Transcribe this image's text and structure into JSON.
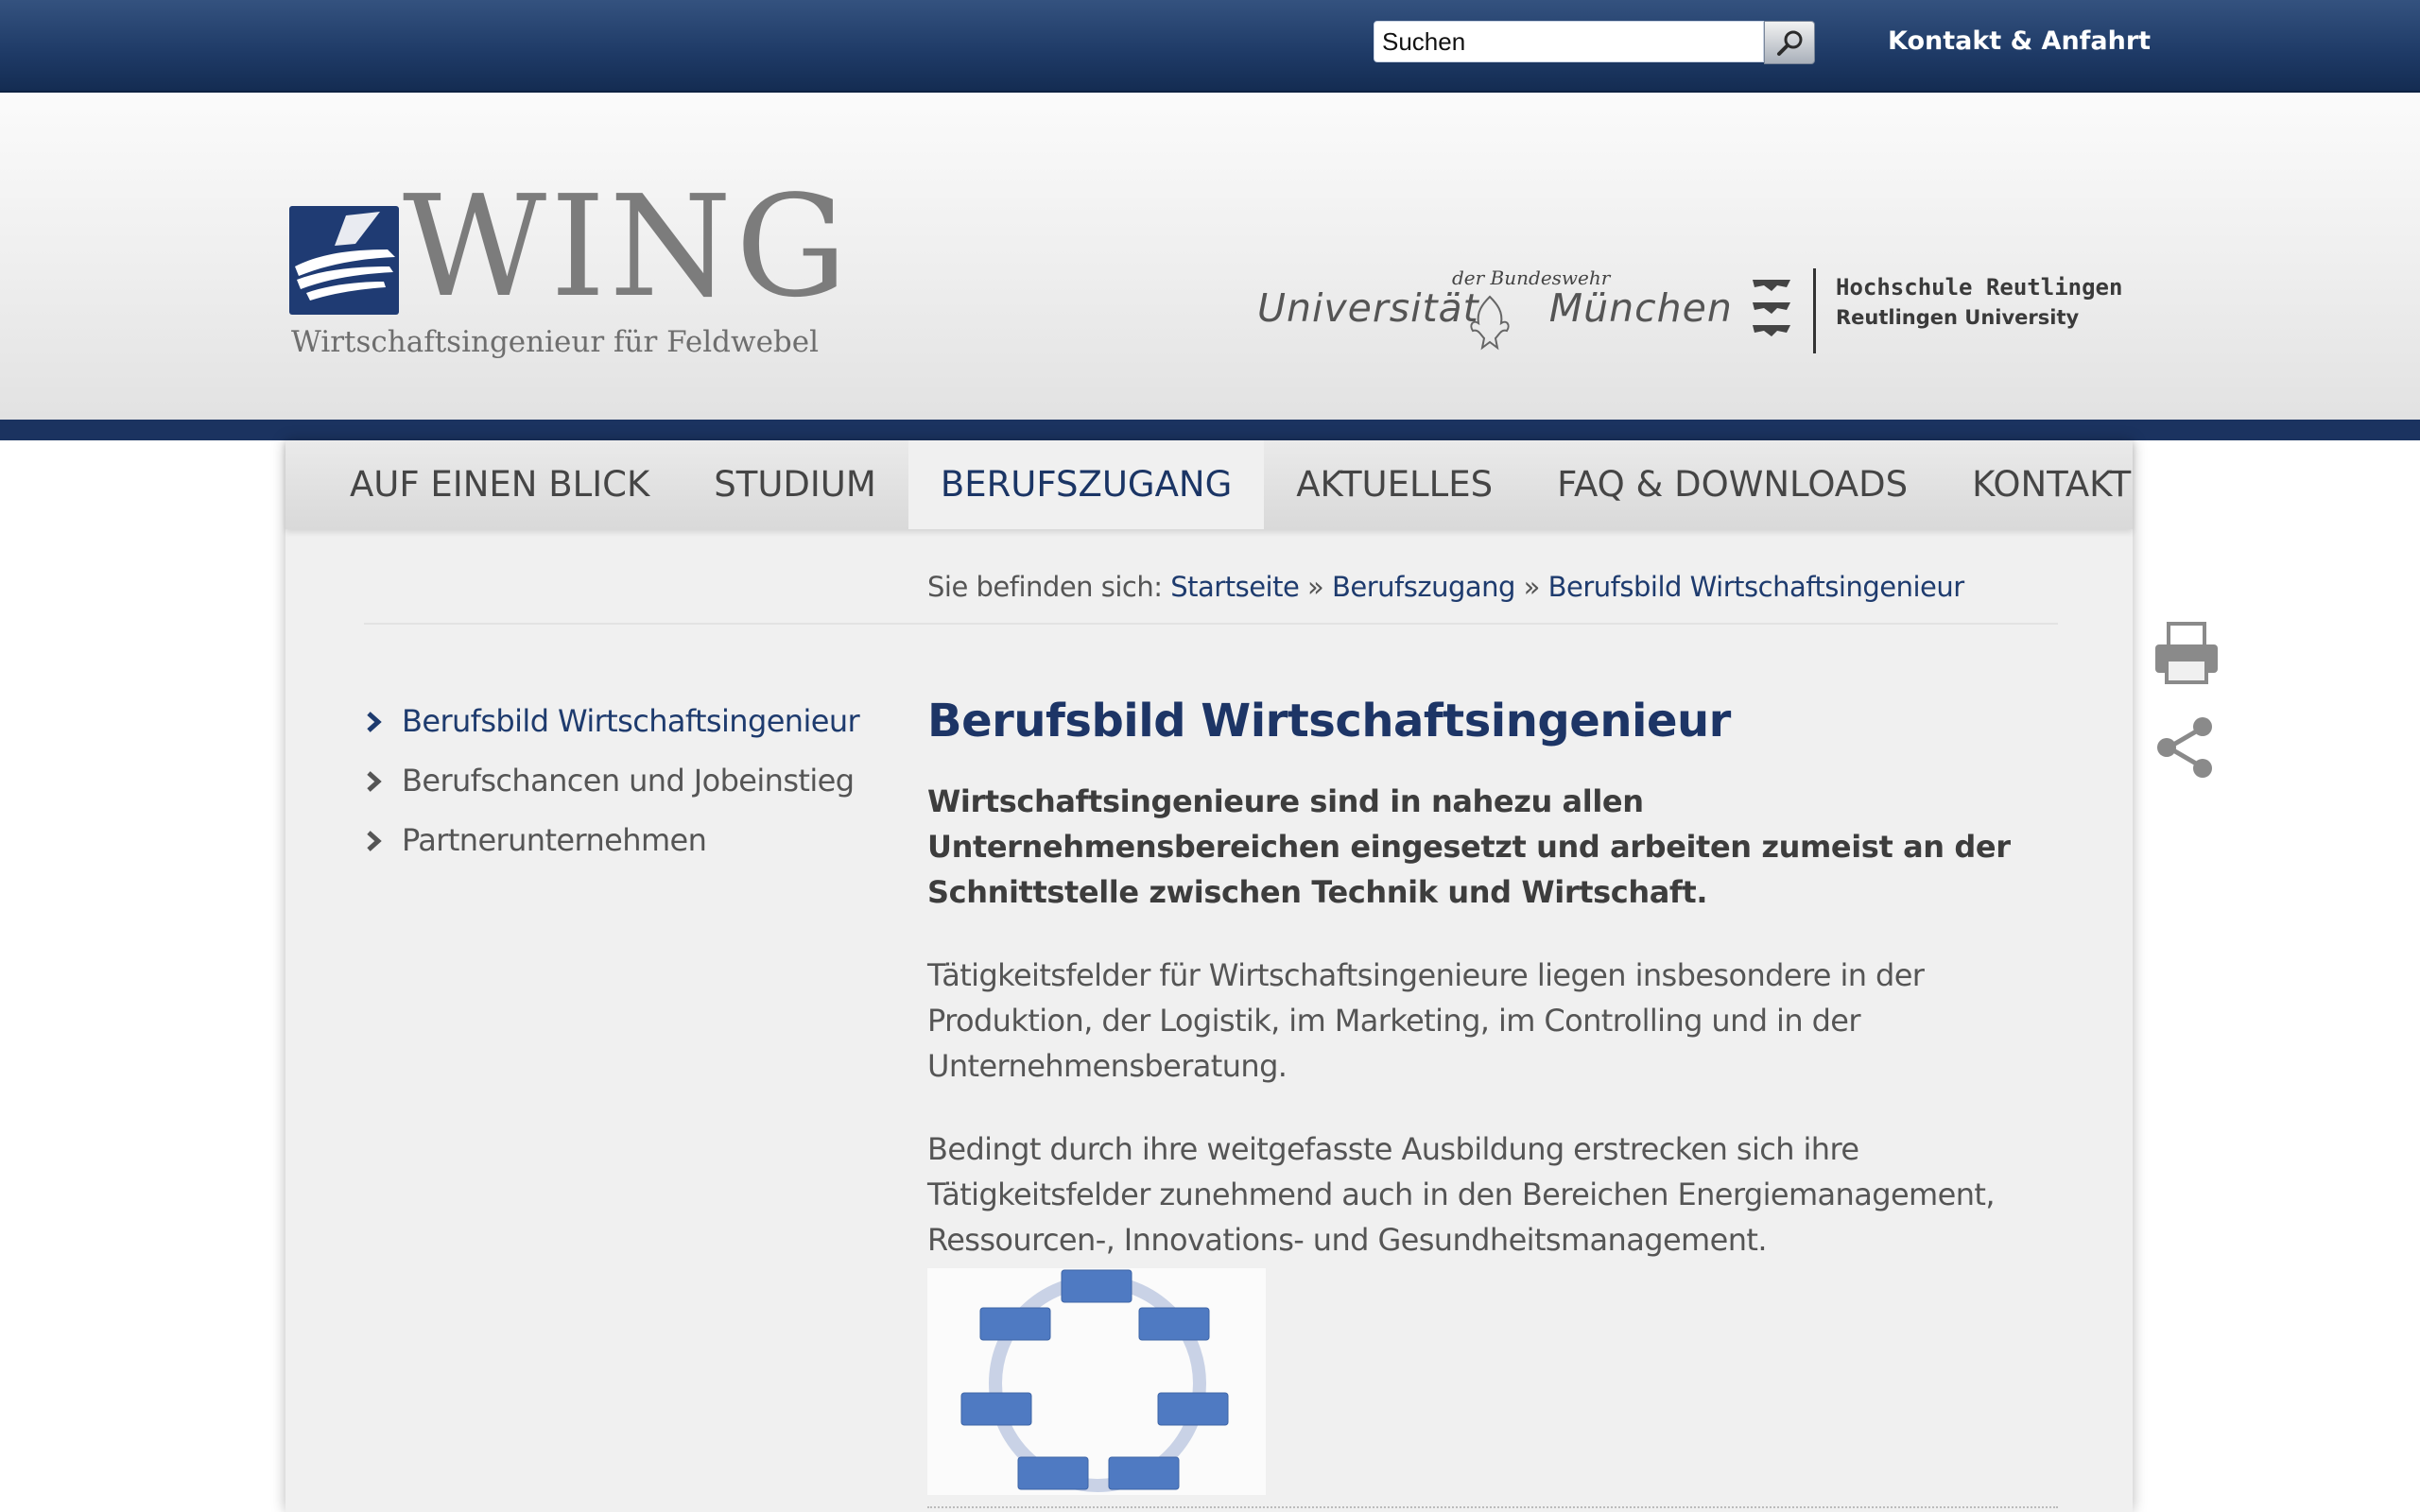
{
  "topbar": {
    "search_placeholder": "Suchen",
    "search_icon": "magnifier-icon",
    "contact_label": "Kontakt & Anfahrt"
  },
  "header": {
    "logo_word": "WING",
    "logo_subtitle": "Wirtschaftsingenieur für Feldwebel",
    "unibw_small": "der Bundeswehr",
    "unibw_left": "Universität",
    "unibw_right": "München",
    "hsr_title": "Hochschule Reutlingen",
    "hsr_subtitle": "Reutlingen University"
  },
  "nav": {
    "items": [
      {
        "label": "AUF EINEN BLICK"
      },
      {
        "label": "STUDIUM"
      },
      {
        "label": "BERUFSZUGANG"
      },
      {
        "label": "AKTUELLES"
      },
      {
        "label": "FAQ & DOWNLOADS"
      },
      {
        "label": "KONTAKT"
      }
    ],
    "active": "BERUFSZUGANG"
  },
  "breadcrumb": {
    "prefix": "Sie befinden sich:",
    "items": [
      "Startseite",
      "Berufszugang",
      "Berufsbild Wirtschaftsingenieur"
    ],
    "separator": "»"
  },
  "sidebar": {
    "items": [
      {
        "label": "Berufsbild Wirtschaftsingenieur"
      },
      {
        "label": "Berufschancen und Jobeinstieg"
      },
      {
        "label": "Partnerunternehmen"
      }
    ]
  },
  "article": {
    "title": "Berufsbild Wirtschaftsingenieur",
    "lead": "Wirtschaftsingenieure sind in nahezu allen Unternehmensbereichen eingesetzt und arbeiten zumeist an der Schnittstelle zwischen Technik und Wirtschaft.",
    "paragraphs": [
      "Tätigkeitsfelder für Wirtschaftsingenieure liegen insbesondere in der Produktion, der Logistik, im Marketing, im Controlling und in der Unternehmensberatung.",
      "Bedingt durch ihre weitgefasste Ausbildung erstrecken sich ihre Tätigkeitsfelder zunehmend auch in den Bereichen Energiemanagement, Ressourcen-, Innovations- und Gesundheitsmanagement."
    ]
  },
  "colors": {
    "brand_dark_blue": "#1b3360",
    "link_blue": "#1e3b6e",
    "panel_bg": "#f0f0f0"
  },
  "icons": [
    "print-icon",
    "share-icon",
    "chevron-right-icon",
    "magnifier-icon"
  ]
}
